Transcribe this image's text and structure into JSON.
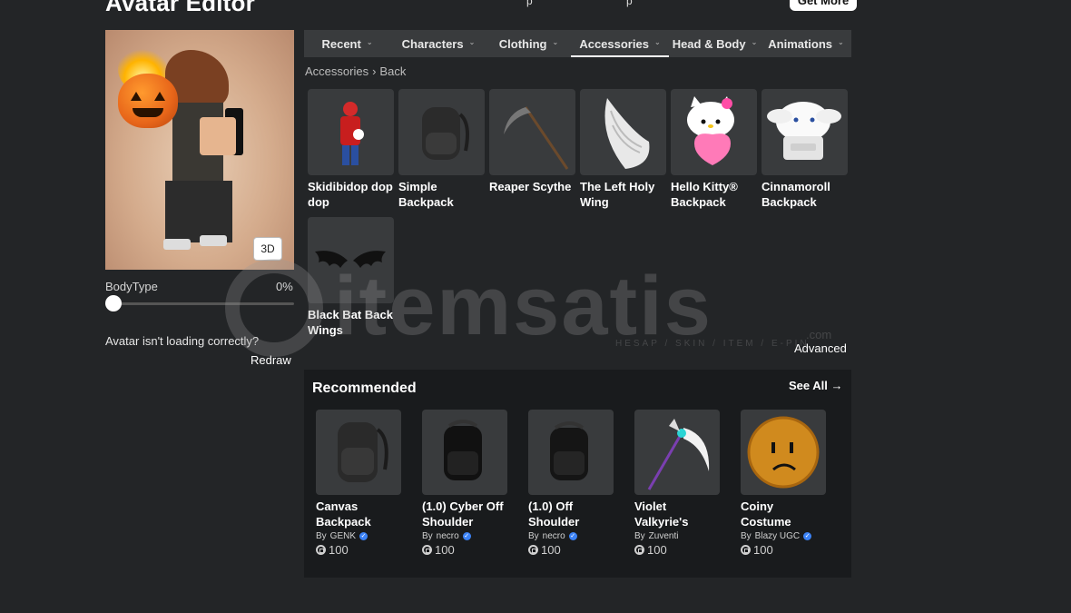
{
  "header": {
    "title": "Avatar Editor",
    "get_more_label": "Get More"
  },
  "avatar": {
    "btn_3d": "3D",
    "bodytype_label": "BodyType",
    "bodytype_value": "0%",
    "bodytype_level": 0,
    "issue_text": "Avatar isn't loading correctly?",
    "redraw_label": "Redraw"
  },
  "tabs": [
    {
      "label": "Recent",
      "active": false
    },
    {
      "label": "Characters",
      "active": false
    },
    {
      "label": "Clothing",
      "active": false
    },
    {
      "label": "Accessories",
      "active": true
    },
    {
      "label": "Head & Body",
      "active": false
    },
    {
      "label": "Animations",
      "active": false
    }
  ],
  "breadcrumb": {
    "parent": "Accessories",
    "separator": "›",
    "current": "Back"
  },
  "items": [
    {
      "name": "Skidibidop dop dop",
      "icon": "red-character-icon"
    },
    {
      "name": "Simple Backpack",
      "icon": "backpack-icon"
    },
    {
      "name": "Reaper Scythe",
      "icon": "scythe-icon"
    },
    {
      "name": "The Left Holy Wing",
      "icon": "wing-icon"
    },
    {
      "name": "Hello Kitty® Backpack",
      "icon": "hello-kitty-icon"
    },
    {
      "name": "Cinnamoroll Backpack",
      "icon": "cinnamoroll-icon"
    },
    {
      "name": "Black Bat Back Wings",
      "icon": "bat-wings-icon"
    }
  ],
  "advanced_label": "Advanced",
  "recommended": {
    "title": "Recommended",
    "see_all": "See All →",
    "by_label": "By",
    "items": [
      {
        "name": "Canvas Backpack",
        "creator": "GENK",
        "verified": true,
        "price": "100",
        "icon": "backpack-icon"
      },
      {
        "name": "(1.0) Cyber Off Shoulder",
        "creator": "necro",
        "verified": true,
        "price": "100",
        "icon": "backpack-icon"
      },
      {
        "name": "(1.0) Off Shoulder",
        "creator": "necro",
        "verified": true,
        "price": "100",
        "icon": "backpack-icon"
      },
      {
        "name": "Violet Valkyrie's",
        "creator": "Zuventi",
        "verified": false,
        "price": "100",
        "icon": "scythe-icon"
      },
      {
        "name": "Coiny Costume",
        "creator": "Blazy UGC",
        "verified": true,
        "price": "100",
        "icon": "coin-face-icon"
      }
    ]
  },
  "watermark": {
    "text": "itemsatis",
    "sub": "HESAP / SKIN / ITEM / E-PIN",
    "com": ".com"
  }
}
